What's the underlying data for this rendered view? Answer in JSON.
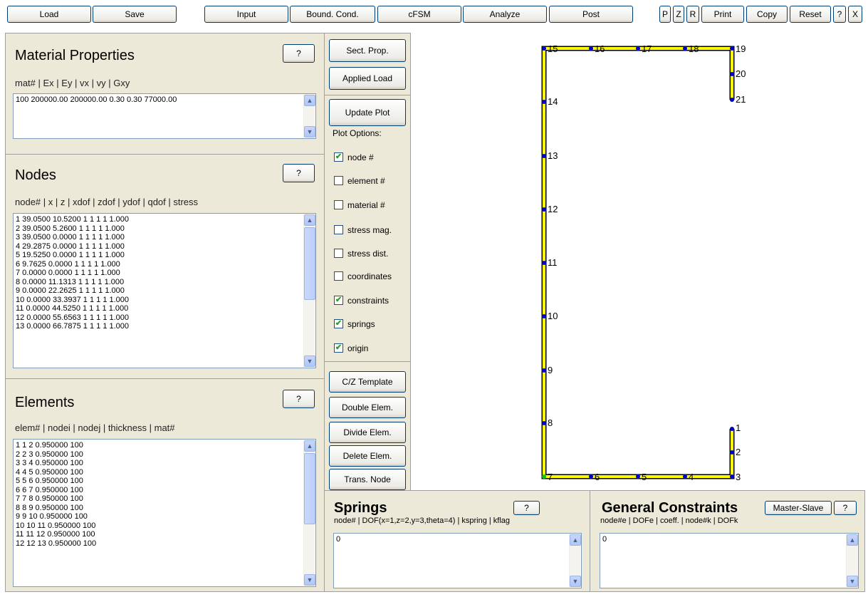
{
  "toolbar": {
    "load": "Load",
    "save": "Save",
    "input": "Input",
    "bound_cond": "Bound. Cond.",
    "cfsm": "cFSM",
    "analyze": "Analyze",
    "post": "Post",
    "p": "P",
    "z": "Z",
    "r": "R",
    "print": "Print",
    "copy": "Copy",
    "reset": "Reset",
    "help": "?",
    "close": "X"
  },
  "material": {
    "title": "Material Properties",
    "help": "?",
    "header": "mat# | Ex | Ey | vx | vy | Gxy",
    "rows": [
      "100 200000.00 200000.00 0.30 0.30 77000.00"
    ]
  },
  "nodes": {
    "title": "Nodes",
    "help": "?",
    "header": "node# | x | z | xdof | zdof | ydof | qdof | stress",
    "rows": [
      "1 39.0500 10.5200 1 1 1 1 1.000",
      "2 39.0500 5.2600 1 1 1 1 1.000",
      "3 39.0500 0.0000 1 1 1 1 1.000",
      "4 29.2875 0.0000 1 1 1 1 1.000",
      "5 19.5250 0.0000 1 1 1 1 1.000",
      "6 9.7625 0.0000 1 1 1 1 1.000",
      "7 0.0000 0.0000 1 1 1 1 1.000",
      "8 0.0000 11.1313 1 1 1 1 1.000",
      "9 0.0000 22.2625 1 1 1 1 1.000",
      "10 0.0000 33.3937 1 1 1 1 1.000",
      "11 0.0000 44.5250 1 1 1 1 1.000",
      "12 0.0000 55.6563 1 1 1 1 1.000",
      "13 0.0000 66.7875 1 1 1 1 1.000"
    ]
  },
  "elements": {
    "title": "Elements",
    "help": "?",
    "header": "elem# | nodei | nodej | thickness | mat#",
    "rows": [
      "1 1 2 0.950000 100",
      "2 2 3 0.950000 100",
      "3 3 4 0.950000 100",
      "4 4 5 0.950000 100",
      "5 5 6 0.950000 100",
      "6 6 7 0.950000 100",
      "7 7 8 0.950000 100",
      "8 8 9 0.950000 100",
      "9 9 10 0.950000 100",
      "10 10 11 0.950000 100",
      "11 11 12 0.950000 100",
      "12 12 13 0.950000 100"
    ]
  },
  "middle": {
    "sect_prop": "Sect. Prop.",
    "applied_load": "Applied Load",
    "update_plot": "Update Plot",
    "plot_options": "Plot Options:",
    "options": [
      {
        "label": "node #",
        "checked": true
      },
      {
        "label": "element #",
        "checked": false
      },
      {
        "label": "material #",
        "checked": false
      },
      {
        "label": "stress mag.",
        "checked": false
      },
      {
        "label": "stress dist.",
        "checked": false
      },
      {
        "label": "coordinates",
        "checked": false
      },
      {
        "label": "constraints",
        "checked": true
      },
      {
        "label": "springs",
        "checked": true
      },
      {
        "label": "origin",
        "checked": true
      }
    ],
    "check_mark": "✔",
    "cz_template": "C/Z Template",
    "double_elem": "Double Elem.",
    "divide_elem": "Divide Elem.",
    "delete_elem": "Delete Elem.",
    "trans_node": "Trans. Node"
  },
  "springs": {
    "title": "Springs",
    "help": "?",
    "header": "node# | DOF(x=1,z=2,y=3,theta=4) | kspring | kflag",
    "value": "0"
  },
  "constraints": {
    "title": "General Constraints",
    "master_slave": "Master-Slave",
    "help": "?",
    "header": "node#e | DOFe | coeff. | node#k | DOFk",
    "value": "0"
  },
  "plot": {
    "section_color": "#ffff00",
    "outline_color": "#000000",
    "node_color": "#0000cc",
    "origin_color": "#00cc00",
    "node_labels": [
      "1",
      "2",
      "3",
      "4",
      "5",
      "6",
      "7",
      "8",
      "9",
      "10",
      "11",
      "12",
      "13",
      "14",
      "15",
      "16",
      "17",
      "18",
      "19",
      "20",
      "21"
    ]
  },
  "scroll": {
    "up": "▲",
    "down": "▼"
  }
}
